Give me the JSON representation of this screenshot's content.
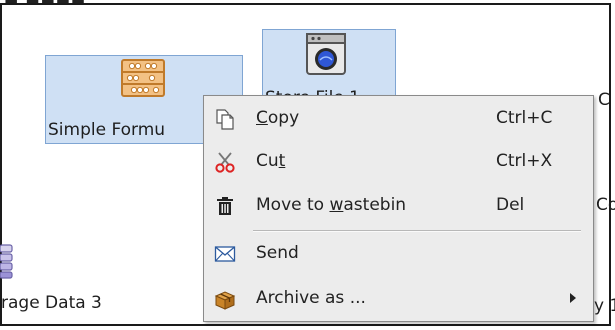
{
  "canvas": {
    "nodes": [
      {
        "label": "Simple Formu",
        "icon": "abacus-icon"
      },
      {
        "label": "Store File 1",
        "icon": "washing-machine-icon"
      }
    ],
    "storage_node": {
      "label": "rage Data 3",
      "icon": "database-stack-icon"
    },
    "side_texts": [
      {
        "text": "C"
      },
      {
        "text": "Co"
      },
      {
        "text": "y 1"
      }
    ]
  },
  "context_menu": {
    "items": [
      {
        "id": "copy",
        "label_pre": "",
        "label_ul": "C",
        "label_post": "opy",
        "shortcut": "Ctrl+C",
        "icon": "copy-icon"
      },
      {
        "id": "cut",
        "label_pre": "Cu",
        "label_ul": "t",
        "label_post": "",
        "shortcut": "Ctrl+X",
        "icon": "scissors-icon"
      },
      {
        "id": "wastebin",
        "label_pre": "Move to ",
        "label_ul": "w",
        "label_post": "astebin",
        "shortcut": "Del",
        "icon": "trash-icon"
      },
      {
        "id": "send",
        "label_pre": "Send",
        "label_ul": "",
        "label_post": "",
        "shortcut": "",
        "icon": "envelope-icon"
      },
      {
        "id": "archive",
        "label_pre": "Archive as ...",
        "label_ul": "",
        "label_post": "",
        "shortcut": "",
        "icon": "archive-box-icon",
        "has_submenu": true
      }
    ]
  },
  "colors": {
    "node_fill": "#cfe0f4",
    "node_border": "#7fa5d3",
    "menu_bg": "#ececec"
  }
}
